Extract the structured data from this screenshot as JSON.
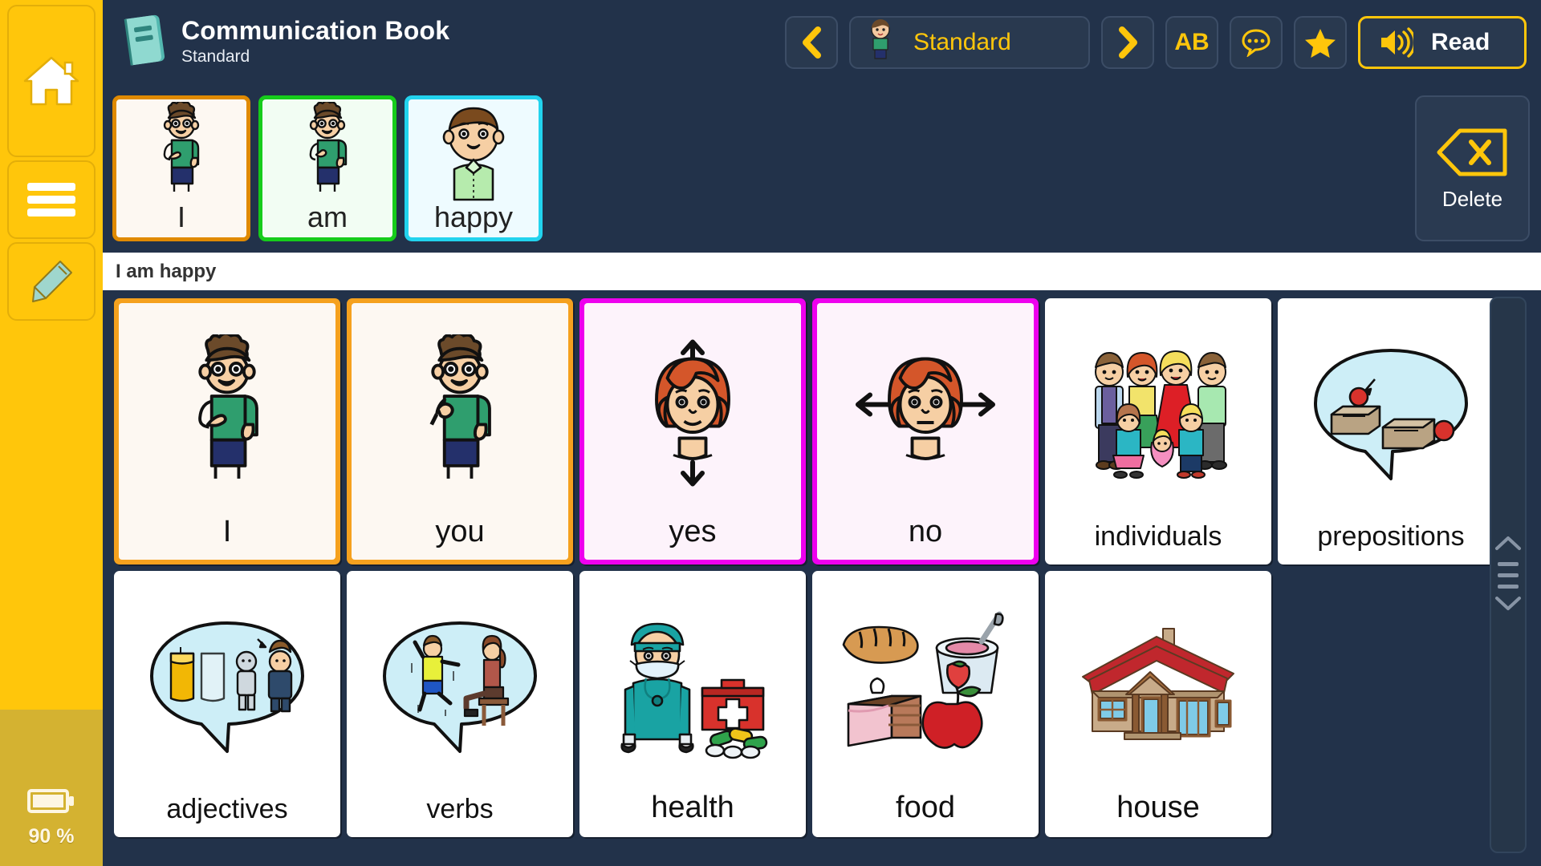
{
  "app": {
    "title": "Communication Book",
    "subtitle": "Standard",
    "book_icon": "book-icon"
  },
  "sidebar": {
    "items": [
      {
        "name": "home",
        "icon": "home-icon"
      },
      {
        "name": "menu",
        "icon": "hamburger-menu-icon"
      },
      {
        "name": "edit",
        "icon": "pencil-icon"
      }
    ],
    "battery": {
      "icon": "battery-icon",
      "level_label": "90 %"
    }
  },
  "toolbar": {
    "prev_label": "❮",
    "next_label": "❯",
    "profile_name": "Standard",
    "profile_icon": "avatar-icon",
    "keyboard_label": "AB",
    "phrases_icon": "speech-bubble-icon",
    "favorites_icon": "star-icon",
    "read_label": "Read",
    "read_icon": "speaker-icon"
  },
  "sentence": {
    "text": "I am happy",
    "tiles": [
      {
        "label": "I",
        "art": "boy-pointing-self",
        "border": "#e08a00",
        "bg": "#fdf8f2"
      },
      {
        "label": "am",
        "art": "boy-pointing-self-2",
        "border": "#16cc1b",
        "bg": "#f2fdf3"
      },
      {
        "label": "happy",
        "art": "happy-boy-face",
        "border": "#22d3ee",
        "bg": "#eefbff"
      }
    ],
    "delete_label": "Delete",
    "delete_icon": "backspace-delete-icon"
  },
  "grid": {
    "cells": [
      {
        "label": "I",
        "art": "boy-pointing-self",
        "style": "b-orange",
        "type": "word"
      },
      {
        "label": "you",
        "art": "boy-pointing-forward",
        "style": "b-orange",
        "type": "word"
      },
      {
        "label": "yes",
        "art": "girl-nodding-yes",
        "style": "b-magenta",
        "type": "word"
      },
      {
        "label": "no",
        "art": "girl-shaking-head-no",
        "style": "b-magenta",
        "type": "word"
      },
      {
        "label": "individuals",
        "art": "family-group",
        "style": "plain",
        "type": "category"
      },
      {
        "label": "prepositions",
        "art": "speech-bubble-boxes",
        "style": "plain",
        "type": "category"
      },
      {
        "label": "adjectives",
        "art": "speech-bubble-compare",
        "style": "plain",
        "type": "category"
      },
      {
        "label": "verbs",
        "art": "speech-bubble-actions",
        "style": "plain",
        "type": "category"
      },
      {
        "label": "health",
        "art": "doctor-first-aid",
        "style": "plain",
        "type": "category"
      },
      {
        "label": "food",
        "art": "bread-yogurt-cake-apple",
        "style": "plain",
        "type": "category"
      },
      {
        "label": "house",
        "art": "house-red-roof",
        "style": "plain",
        "type": "category"
      }
    ]
  },
  "scrollbar": {
    "up_icon": "chevron-up-icon",
    "grip_icon": "grip-lines-icon",
    "down_icon": "chevron-down-icon"
  },
  "colors": {
    "sidebar_yellow": "#FFC60B",
    "sidebar_muted": "#D4B231",
    "panel_navy": "#22324a",
    "accent_yellow": "#FFC60B",
    "orange_border": "#f5a11e",
    "magenta_border": "#ee00ee"
  }
}
